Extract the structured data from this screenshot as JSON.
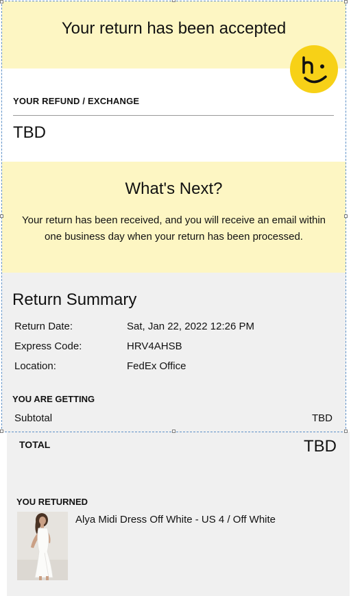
{
  "header": {
    "title": "Your return has been accepted",
    "logo_icon": "smiley-h-logo",
    "logo_color": "#f7d117"
  },
  "refund": {
    "label": "YOUR REFUND / EXCHANGE",
    "value": "TBD"
  },
  "next": {
    "heading": "What's Next?",
    "body": "Your return has been received, and you will receive an email within one business day when your return has been processed."
  },
  "summary": {
    "heading": "Return Summary",
    "rows": [
      {
        "label": "Return Date:",
        "value": "Sat, Jan 22, 2022 12:26 PM"
      },
      {
        "label": "Express Code:",
        "value": "HRV4AHSB"
      },
      {
        "label": "Location:",
        "value": "FedEx Office"
      }
    ],
    "getting_label": "YOU ARE GETTING",
    "subtotal_label": "Subtotal",
    "subtotal_value": "TBD",
    "total_label": "TOTAL",
    "total_value": "TBD"
  },
  "returned": {
    "label": "YOU RETURNED",
    "items": [
      {
        "name": "Alya Midi Dress Off White - US 4 / Off White",
        "image": "product-photo"
      }
    ]
  },
  "colors": {
    "yellow_bg": "#fdf6c3",
    "gray_bg": "#f0f0f0",
    "selection_border": "#5b8fc7"
  }
}
